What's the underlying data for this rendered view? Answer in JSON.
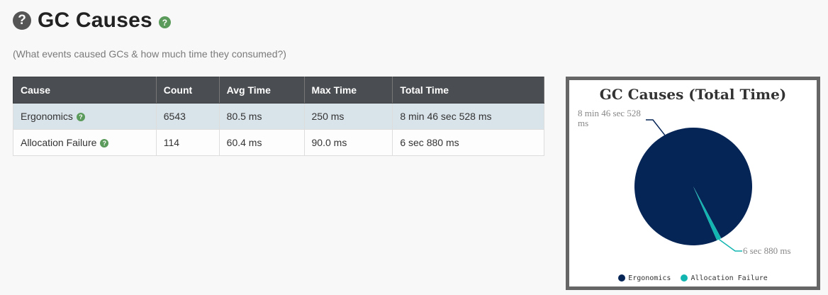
{
  "page": {
    "title": "GC Causes",
    "subtitle": "(What events caused GCs & how much time they consumed?)",
    "help_icon": "?",
    "title_help_icon": "?"
  },
  "table": {
    "headers": [
      "Cause",
      "Count",
      "Avg Time",
      "Max Time",
      "Total Time"
    ],
    "rows": [
      {
        "cause": "Ergonomics",
        "count": "6543",
        "avg": "80.5 ms",
        "max": "250 ms",
        "total": "8 min 46 sec 528 ms",
        "help_icon": "?"
      },
      {
        "cause": "Allocation Failure",
        "count": "114",
        "avg": "60.4 ms",
        "max": "90.0 ms",
        "total": "6 sec 880 ms",
        "help_icon": "?"
      }
    ]
  },
  "chart_data": {
    "type": "pie",
    "title": "GC Causes (Total Time)",
    "series": [
      {
        "name": "Ergonomics",
        "value": 526528,
        "label": "8 min 46 sec 528 ms",
        "color": "#062557"
      },
      {
        "name": "Allocation Failure",
        "value": 6880,
        "label": "6 sec 880 ms",
        "color": "#13b5b1"
      }
    ],
    "units": "ms",
    "legend": "bottom"
  },
  "colors": {
    "header_bg": "#4a4d51",
    "row_highlight": "#d9e3ea",
    "help_green": "#5a9a5a",
    "chart_border": "#666666"
  }
}
